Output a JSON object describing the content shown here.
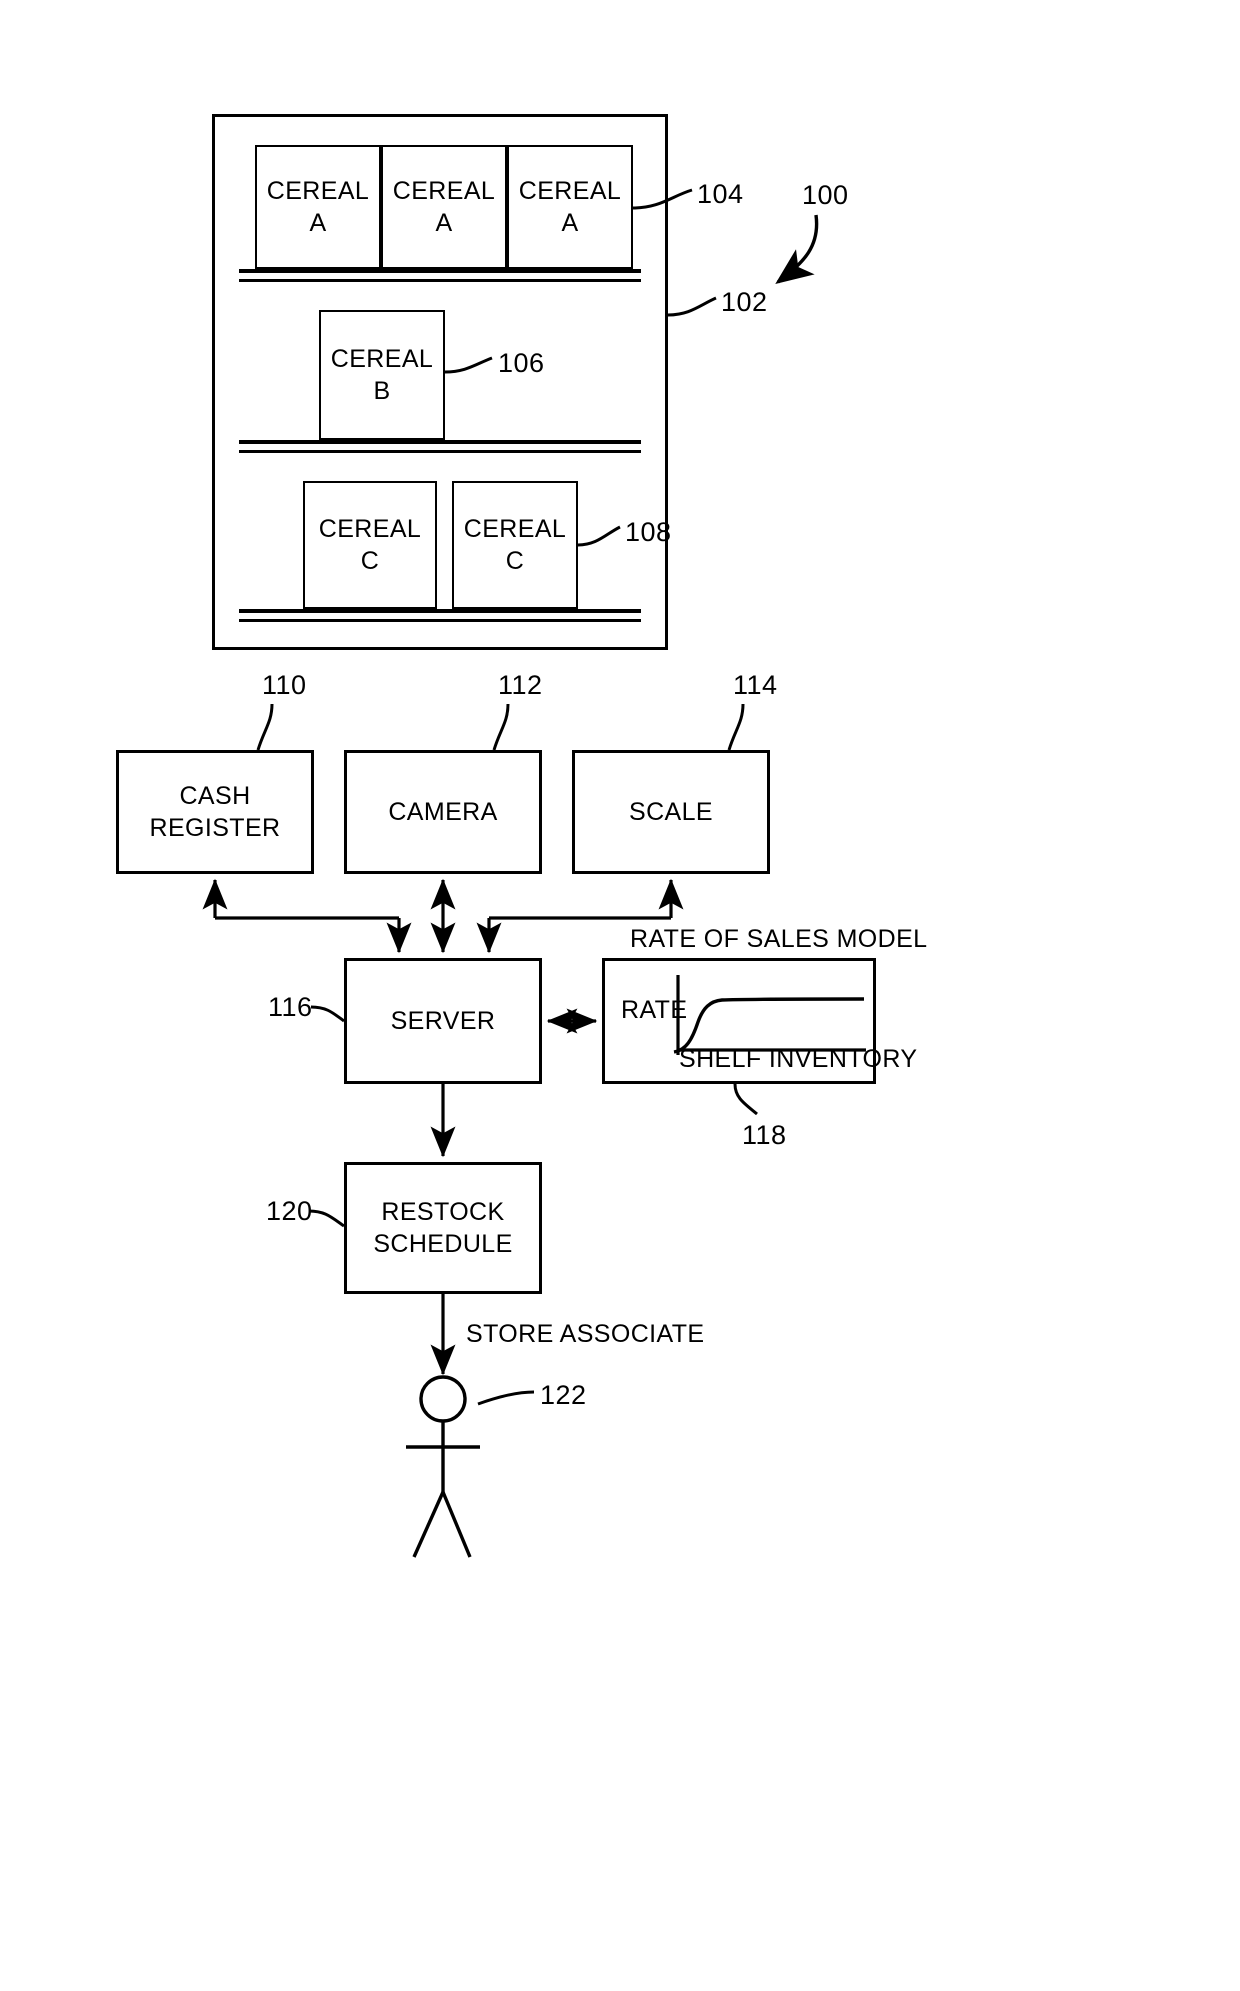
{
  "figure": {
    "title": "Retail shelf inventory monitoring and restock system block diagram",
    "line_color": "#000000",
    "background_color": "#ffffff"
  },
  "shelf_unit": {
    "ref": "102",
    "system_ref": "100",
    "shelves": [
      {
        "ref": "104",
        "products": [
          {
            "name_line1": "CEREAL",
            "name_line2": "A"
          },
          {
            "name_line1": "CEREAL",
            "name_line2": "A"
          },
          {
            "name_line1": "CEREAL",
            "name_line2": "A"
          }
        ]
      },
      {
        "ref": "106",
        "products": [
          {
            "name_line1": "CEREAL",
            "name_line2": "B"
          }
        ]
      },
      {
        "ref": "108",
        "products": [
          {
            "name_line1": "CEREAL",
            "name_line2": "C"
          },
          {
            "name_line1": "CEREAL",
            "name_line2": "C"
          }
        ]
      }
    ]
  },
  "nodes": {
    "cash_register": {
      "ref": "110",
      "line1": "CASH",
      "line2": "REGISTER"
    },
    "camera": {
      "ref": "112",
      "line1": "CAMERA",
      "line2": ""
    },
    "scale": {
      "ref": "114",
      "line1": "SCALE",
      "line2": ""
    },
    "server": {
      "ref": "116",
      "line1": "SERVER",
      "line2": ""
    },
    "rate_of_sales_model": {
      "ref": "118",
      "line1": "",
      "line2": ""
    },
    "restock_schedule": {
      "ref": "120",
      "line1": "RESTOCK",
      "line2": "SCHEDULE"
    },
    "store_associate": {
      "ref": "122",
      "label": "STORE ASSOCIATE"
    }
  },
  "chart_data": {
    "type": "line",
    "title": "RATE OF SALES MODEL",
    "ylabel": "RATE",
    "xlabel": "SHELF INVENTORY",
    "grid": false,
    "legend": null,
    "x": [
      0,
      0.04,
      0.08,
      0.12,
      0.16,
      0.22,
      0.3,
      0.45,
      0.65,
      1.0
    ],
    "y": [
      0.0,
      0.18,
      0.45,
      0.68,
      0.82,
      0.9,
      0.94,
      0.96,
      0.96,
      0.96
    ],
    "xlim": [
      0,
      1
    ],
    "ylim": [
      0,
      1
    ],
    "description": "Saturating curve: sales rate rises steeply with shelf inventory then plateaus"
  },
  "reference_numerals": {
    "system": "100",
    "shelf_unit": "102",
    "shelf_top": "104",
    "shelf_middle": "106",
    "shelf_bottom": "108",
    "cash_register": "110",
    "camera": "112",
    "scale": "114",
    "server": "116",
    "model": "118",
    "restock": "120",
    "associate": "122"
  }
}
